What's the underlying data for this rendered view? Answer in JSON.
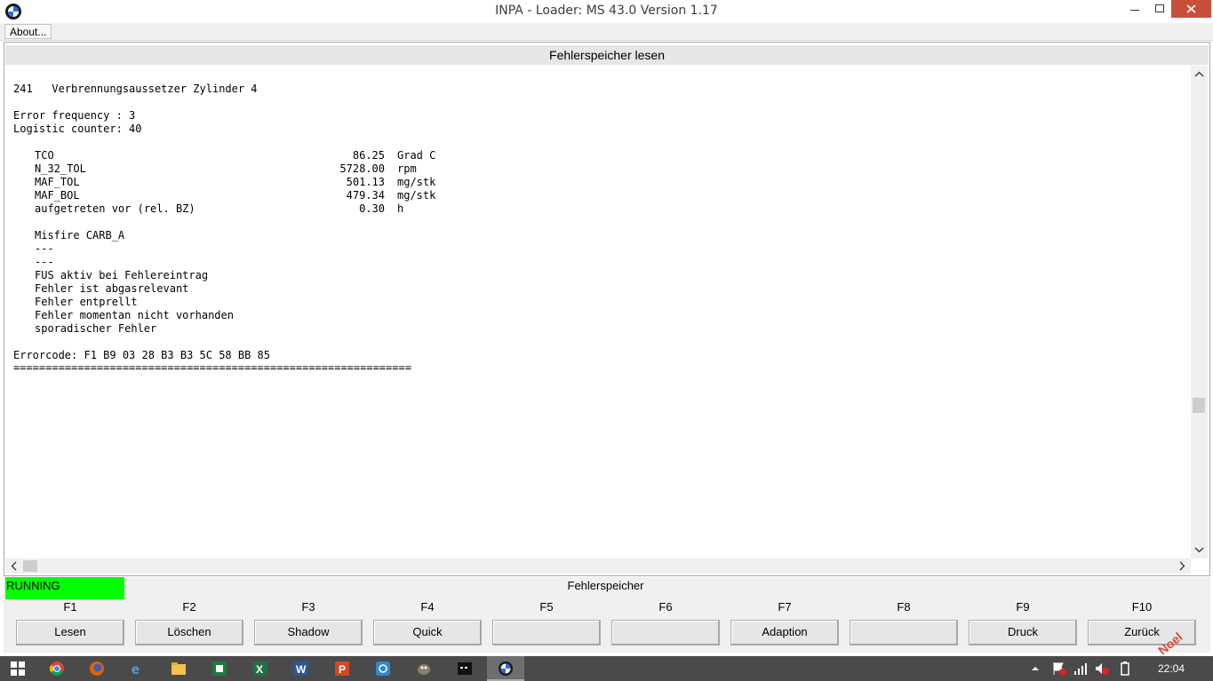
{
  "window": {
    "title": "INPA - Loader:  MS 43.0 Version 1.17"
  },
  "menu": {
    "about": "About..."
  },
  "screen": {
    "title": "Fehlerspeicher lesen"
  },
  "error": {
    "code_line": "241   Verbrennungsaussetzer Zylinder 4",
    "frequency": "Error frequency : 3",
    "logistic": "Logistic counter: 40",
    "params": [
      {
        "name": "TCO",
        "value": "86.25",
        "unit": "Grad C"
      },
      {
        "name": "N_32_TOL",
        "value": "5728.00",
        "unit": "rpm"
      },
      {
        "name": "MAF_TOL",
        "value": "501.13",
        "unit": "mg/stk"
      },
      {
        "name": "MAF_BOL",
        "value": "479.34",
        "unit": "mg/stk"
      },
      {
        "name": "aufgetreten vor (rel. BZ)",
        "value": "0.30",
        "unit": "h"
      }
    ],
    "details": [
      "Misfire CARB_A",
      "---",
      "---",
      "FUS aktiv bei Fehlereintrag",
      "Fehler ist abgasrelevant",
      "Fehler entprellt",
      "Fehler momentan nicht vorhanden",
      "sporadischer Fehler"
    ],
    "errorcode": "Errorcode: F1 B9 03 28 B3 B3 5C 58 BB 85",
    "separator": "=============================================================="
  },
  "status": {
    "running": "RUNNING",
    "label": "Fehlerspeicher",
    "running_color": "#00ff00"
  },
  "fkeys": [
    {
      "key": "F1",
      "label": "Lesen"
    },
    {
      "key": "F2",
      "label": "Löschen"
    },
    {
      "key": "F3",
      "label": "Shadow"
    },
    {
      "key": "F4",
      "label": "Quick"
    },
    {
      "key": "F5",
      "label": ""
    },
    {
      "key": "F6",
      "label": ""
    },
    {
      "key": "F7",
      "label": "Adaption"
    },
    {
      "key": "F8",
      "label": ""
    },
    {
      "key": "F9",
      "label": "Druck"
    },
    {
      "key": "F10",
      "label": "Zurück"
    }
  ],
  "watermark": "Noel",
  "taskbar": {
    "clock": "22:04",
    "icons": [
      "windows-start-icon",
      "chrome-icon",
      "firefox-icon",
      "internet-explorer-icon",
      "file-explorer-icon",
      "excel-green-icon",
      "excel-icon",
      "word-icon",
      "powerpoint-icon",
      "app-blue-icon",
      "gimp-icon",
      "terminal-icon",
      "bmw-inpa-icon"
    ]
  }
}
